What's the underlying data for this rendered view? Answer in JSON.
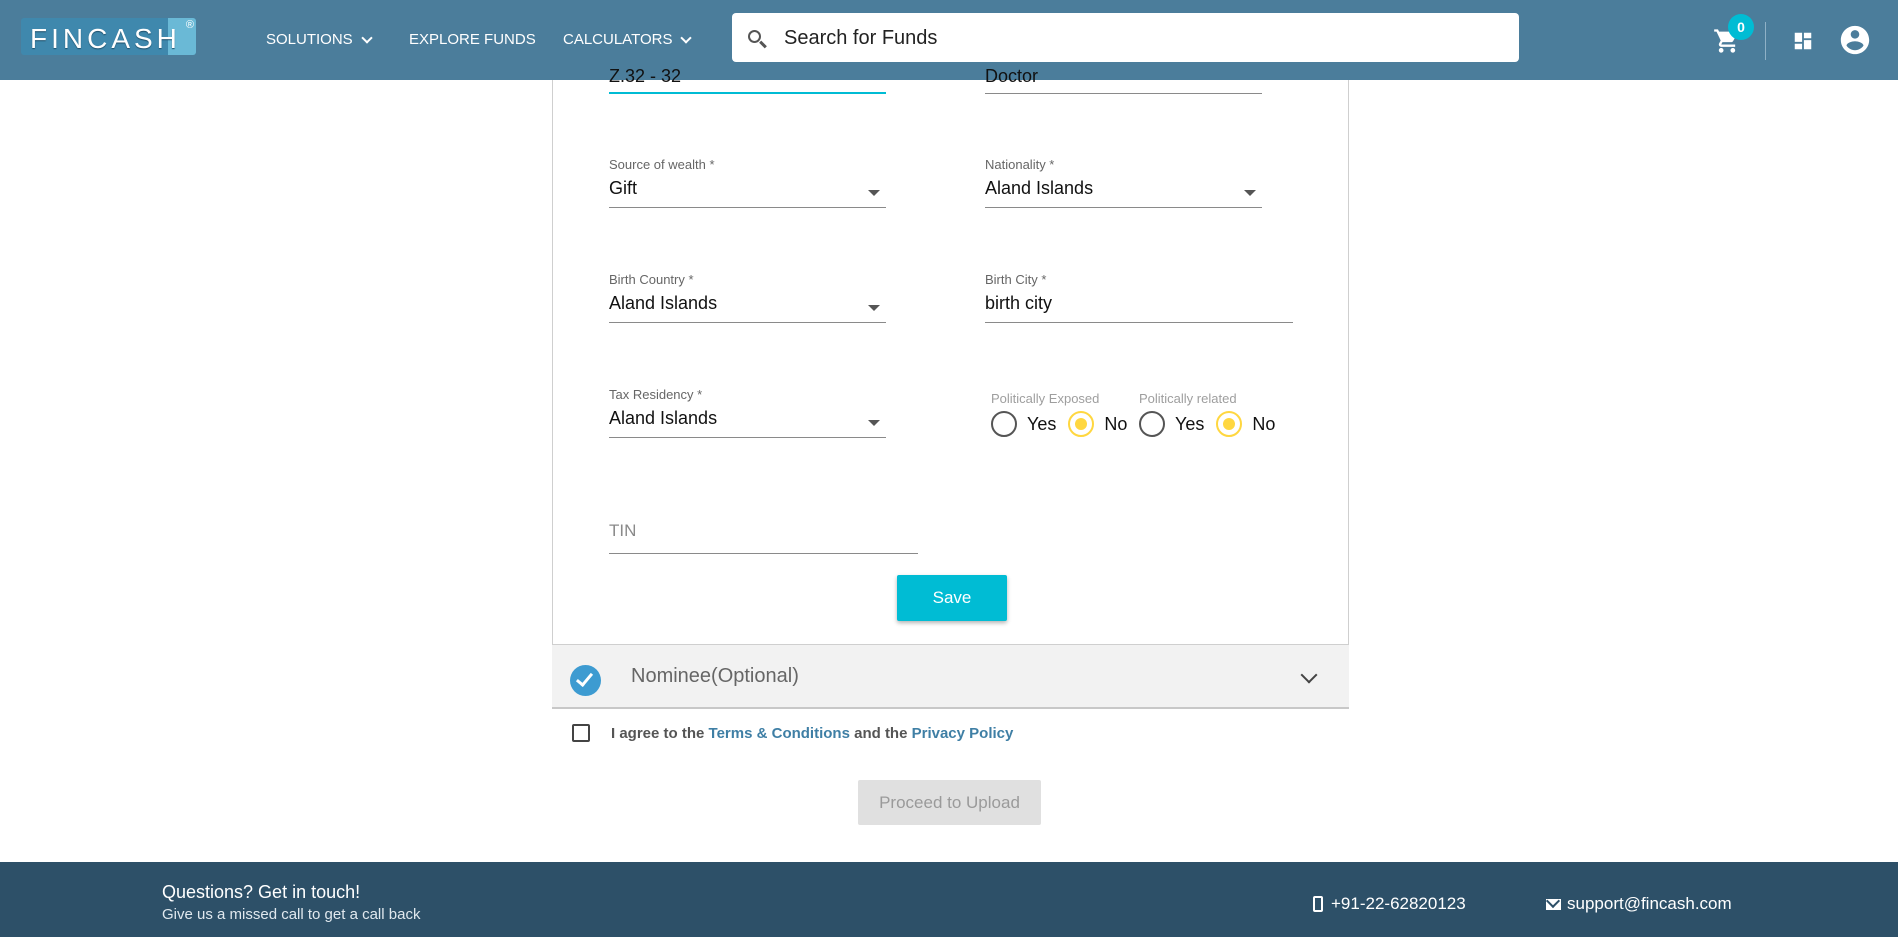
{
  "header": {
    "logo_text": "FINCASH",
    "logo_reg": "®",
    "nav": {
      "solutions": "SOLUTIONS",
      "explore": "EXPLORE FUNDS",
      "calculators": "CALCULATORS"
    },
    "search_placeholder": "Search for Funds",
    "cart_count": "0"
  },
  "form": {
    "top_left_partial": "Z.32 - 32",
    "top_right_partial": "Doctor",
    "source_of_wealth": {
      "label": "Source of wealth *",
      "value": "Gift"
    },
    "nationality": {
      "label": "Nationality *",
      "value": "Aland Islands"
    },
    "birth_country": {
      "label": "Birth Country *",
      "value": "Aland Islands"
    },
    "birth_city": {
      "label": "Birth City *",
      "value": "birth city"
    },
    "tax_residency": {
      "label": "Tax Residency *",
      "value": "Aland Islands"
    },
    "politically_exposed": {
      "label": "Politically Exposed",
      "yes": "Yes",
      "no": "No",
      "selected": "No"
    },
    "politically_related": {
      "label": "Politically related",
      "yes": "Yes",
      "no": "No",
      "selected": "No"
    },
    "tin": {
      "placeholder": "TIN"
    },
    "save_label": "Save"
  },
  "nominee": {
    "title": "Nominee(Optional)"
  },
  "agreement": {
    "prefix": "I agree to the ",
    "terms": "Terms & Conditions",
    "middle": " and the ",
    "privacy": "Privacy Policy"
  },
  "proceed_label": "Proceed to Upload",
  "footer": {
    "question": "Questions? Get in touch!",
    "sub": "Give us a missed call to get a call back",
    "phone": "+91-22-62820123",
    "email": "support@fincash.com"
  },
  "colors": {
    "header_bg": "#4b7d9b",
    "accent": "#00bcd4",
    "radio_selected": "#ffd740",
    "footer_bg": "#2d5068",
    "link": "#3f7fa5"
  }
}
